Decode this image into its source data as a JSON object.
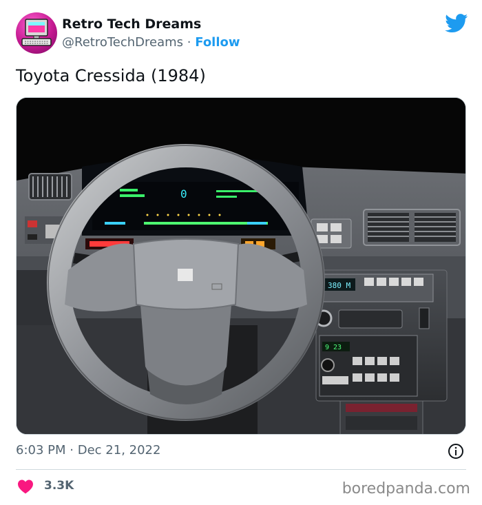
{
  "author": {
    "name": "Retro Tech Dreams",
    "handle": "@RetroTechDreams",
    "separator": "·",
    "follow_label": "Follow"
  },
  "tweet": {
    "text": "Toyota Cressida (1984)",
    "time": "6:03 PM",
    "meta_separator": "·",
    "date": "Dec 21, 2022"
  },
  "media": {
    "radio_display": "380 M",
    "clock_display": "9 23",
    "digital_speed": "0"
  },
  "engagement": {
    "likes": "3.3K"
  },
  "watermark": "boredpanda.com",
  "icons": {
    "platform": "twitter-bird-icon",
    "like": "heart-icon",
    "info": "info-icon"
  },
  "colors": {
    "brand": "#1d9bf0",
    "like": "#f91880",
    "text": "#0f1419",
    "secondary": "#536471"
  }
}
